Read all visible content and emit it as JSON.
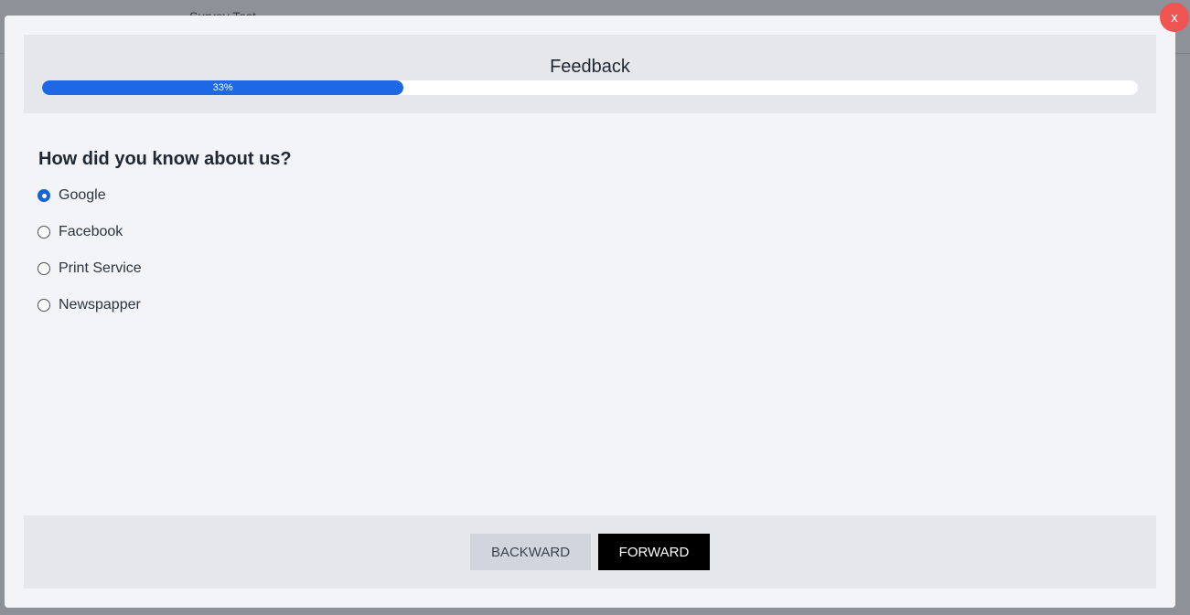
{
  "backdrop": {
    "text": "Survey Test"
  },
  "modal": {
    "close_label": "x",
    "title": "Feedback",
    "progress": {
      "value": 0.33,
      "label": "33%"
    },
    "question": "How did you know about us?",
    "options": [
      {
        "label": "Google",
        "checked": true
      },
      {
        "label": "Facebook",
        "checked": false
      },
      {
        "label": "Print Service",
        "checked": false
      },
      {
        "label": "Newspapper",
        "checked": false
      }
    ],
    "buttons": {
      "backward": "BACKWARD",
      "forward": "FORWARD"
    }
  },
  "colors": {
    "accent": "#1e68e6",
    "close": "#ef5352",
    "forward_bg": "#000000",
    "backward_bg": "#d1d5dd"
  }
}
